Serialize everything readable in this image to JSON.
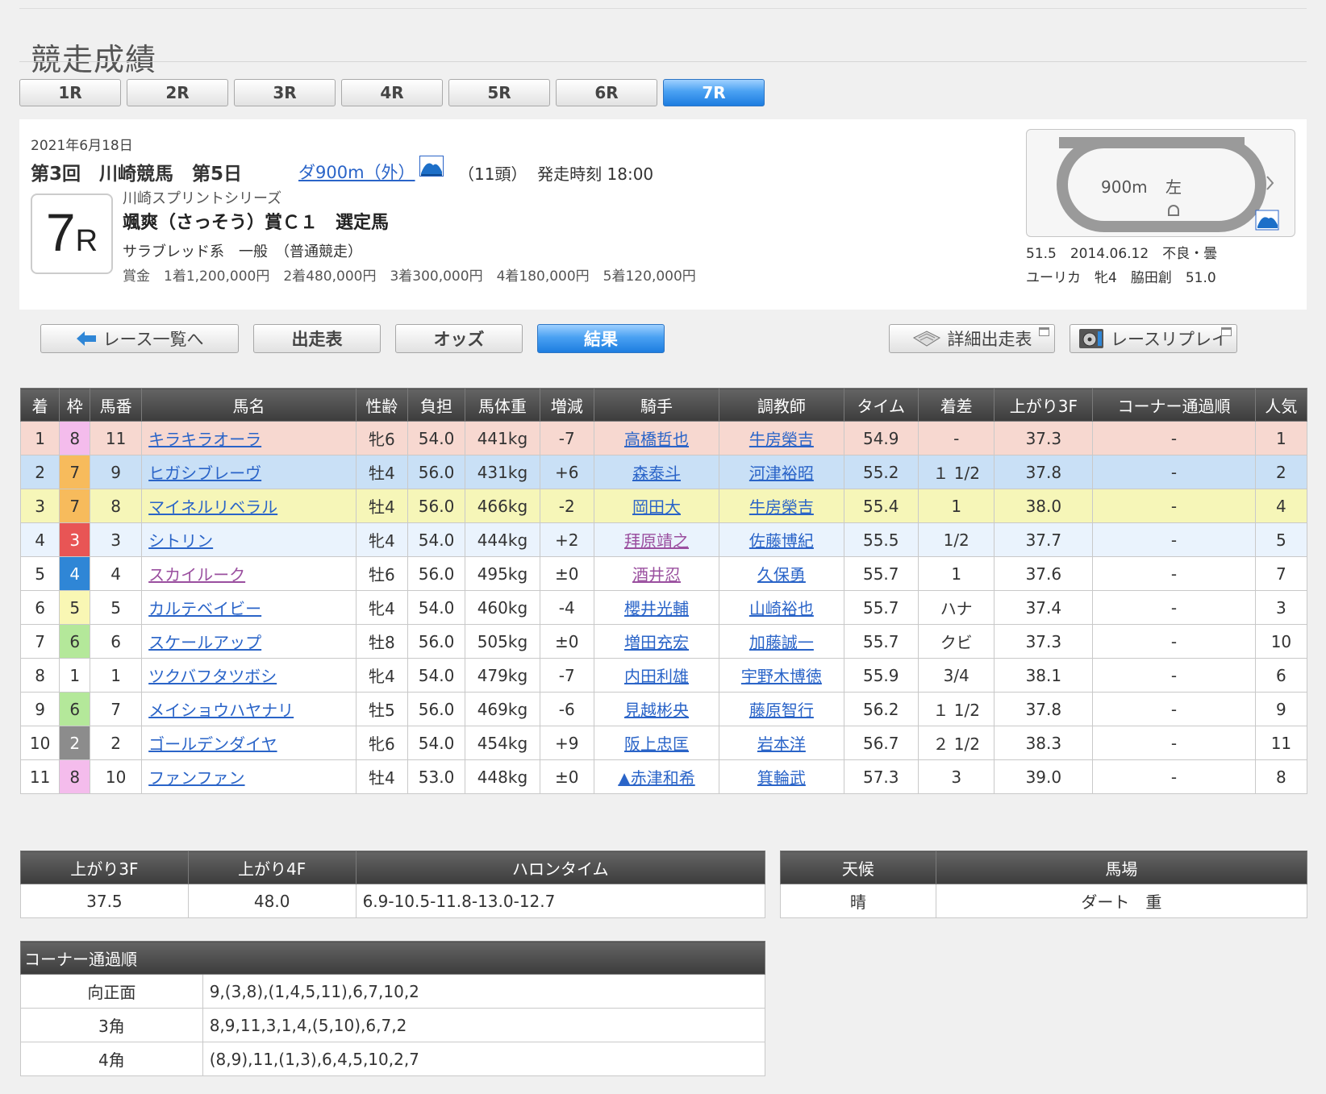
{
  "page_title": "競走成績",
  "race_tabs": [
    "1R",
    "2R",
    "3R",
    "4R",
    "5R",
    "6R",
    "7R"
  ],
  "active_tab": "7R",
  "race_info": {
    "date": "2021年6月18日",
    "meeting": "第3回　川崎競馬　第5日",
    "course": "ダ900m（外）",
    "runners_time": "（11頭）  発走時刻 18:00",
    "race_number": "7",
    "race_number_suffix": "R",
    "series": "川崎スプリントシリーズ",
    "race_name": "颯爽（さっそう）賞Ｃ１　選定馬",
    "race_class": "サラブレッド系　一般　（普通競走）",
    "prize": "賞金　1着1,200,000円　2着480,000円　3着300,000円　4着180,000円　5着120,000円"
  },
  "course_map": {
    "distance_label": "900m",
    "direction_label": "左",
    "record_line1": "51.5　2014.06.12　不良・曇",
    "record_line2": "ユーリカ　牝4　脇田創　51.0"
  },
  "nav": {
    "back_label": "レース一覧へ",
    "entries_label": "出走表",
    "odds_label": "オッズ",
    "results_label": "結果",
    "detail_entries_label": "詳細出走表",
    "replay_label": "レースリプレイ"
  },
  "results_headers": [
    "着",
    "枠",
    "馬番",
    "馬名",
    "性齢",
    "負担",
    "馬体重",
    "増減",
    "騎手",
    "調教師",
    "タイム",
    "着差",
    "上がり3F",
    "コーナー通過順",
    "人気"
  ],
  "results_rows": [
    [
      "1",
      "8",
      "11",
      "キラキラオーラ",
      "牝6",
      "54.0",
      "441kg",
      "-7",
      "高橋哲也",
      "牛房榮吉",
      "54.9",
      "-",
      "37.3",
      "-",
      "1"
    ],
    [
      "2",
      "7",
      "9",
      "ヒガシブレーヴ",
      "牡4",
      "56.0",
      "431kg",
      "+6",
      "森泰斗",
      "河津裕昭",
      "55.2",
      "１ 1/2",
      "37.8",
      "-",
      "2"
    ],
    [
      "3",
      "7",
      "8",
      "マイネルリベラル",
      "牡4",
      "56.0",
      "466kg",
      "-2",
      "岡田大",
      "牛房榮吉",
      "55.4",
      "1",
      "38.0",
      "-",
      "4"
    ],
    [
      "4",
      "3",
      "3",
      "シトリン",
      "牝4",
      "54.0",
      "444kg",
      "+2",
      "拜原靖之",
      "佐藤博紀",
      "55.5",
      "1/2",
      "37.7",
      "-",
      "5"
    ],
    [
      "5",
      "4",
      "4",
      "スカイルーク",
      "牡6",
      "56.0",
      "495kg",
      "±0",
      "酒井忍",
      "久保勇",
      "55.7",
      "1",
      "37.6",
      "-",
      "7"
    ],
    [
      "6",
      "5",
      "5",
      "カルテベイビー",
      "牝4",
      "54.0",
      "460kg",
      "-4",
      "櫻井光輔",
      "山崎裕也",
      "55.7",
      "ハナ",
      "37.4",
      "-",
      "3"
    ],
    [
      "7",
      "6",
      "6",
      "スケールアップ",
      "牡8",
      "56.0",
      "505kg",
      "±0",
      "増田充宏",
      "加藤誠一",
      "55.7",
      "クビ",
      "37.3",
      "-",
      "10"
    ],
    [
      "8",
      "1",
      "1",
      "ツクバフタツボシ",
      "牝4",
      "54.0",
      "479kg",
      "-7",
      "内田利雄",
      "宇野木博徳",
      "55.9",
      "3/4",
      "38.1",
      "-",
      "6"
    ],
    [
      "9",
      "6",
      "7",
      "メイショウハヤナリ",
      "牡5",
      "56.0",
      "469kg",
      "-6",
      "見越彬央",
      "藤原智行",
      "56.2",
      "１ 1/2",
      "37.8",
      "-",
      "9"
    ],
    [
      "10",
      "2",
      "2",
      "ゴールデンダイヤ",
      "牝6",
      "54.0",
      "454kg",
      "+9",
      "阪上忠匡",
      "岩本洋",
      "56.7",
      "２ 1/2",
      "38.3",
      "-",
      "11"
    ],
    [
      "11",
      "8",
      "10",
      "ファンファン",
      "牡4",
      "53.0",
      "448kg",
      "±0",
      "▲赤津和希",
      "箕輪武",
      "57.3",
      "3",
      "39.0",
      "-",
      "8"
    ]
  ],
  "lap": {
    "headers": [
      "上がり3F",
      "上がり4F",
      "ハロンタイム"
    ],
    "values": [
      "37.5",
      "48.0",
      "6.9-10.5-11.8-13.0-12.7"
    ]
  },
  "condition": {
    "headers": [
      "天候",
      "馬場"
    ],
    "values": [
      "晴",
      "ダート　重"
    ]
  },
  "corners": {
    "header": "コーナー通過順",
    "rows": [
      [
        "向正面",
        "9,(3,8),(1,4,5,11),6,7,10,2"
      ],
      [
        "3角",
        "8,9,11,3,1,4,(5,10),6,7,2"
      ],
      [
        "4角",
        "(8,9),11,(1,3),6,4,5,10,2,7"
      ]
    ]
  },
  "colors": {
    "accent_blue": "#1d7de0",
    "link": "#2a64c8",
    "visited_link": "#9a4f9f",
    "first_row": "#f7d8d0",
    "second_row": "#c9e0f6",
    "third_row": "#f6f6b8"
  }
}
